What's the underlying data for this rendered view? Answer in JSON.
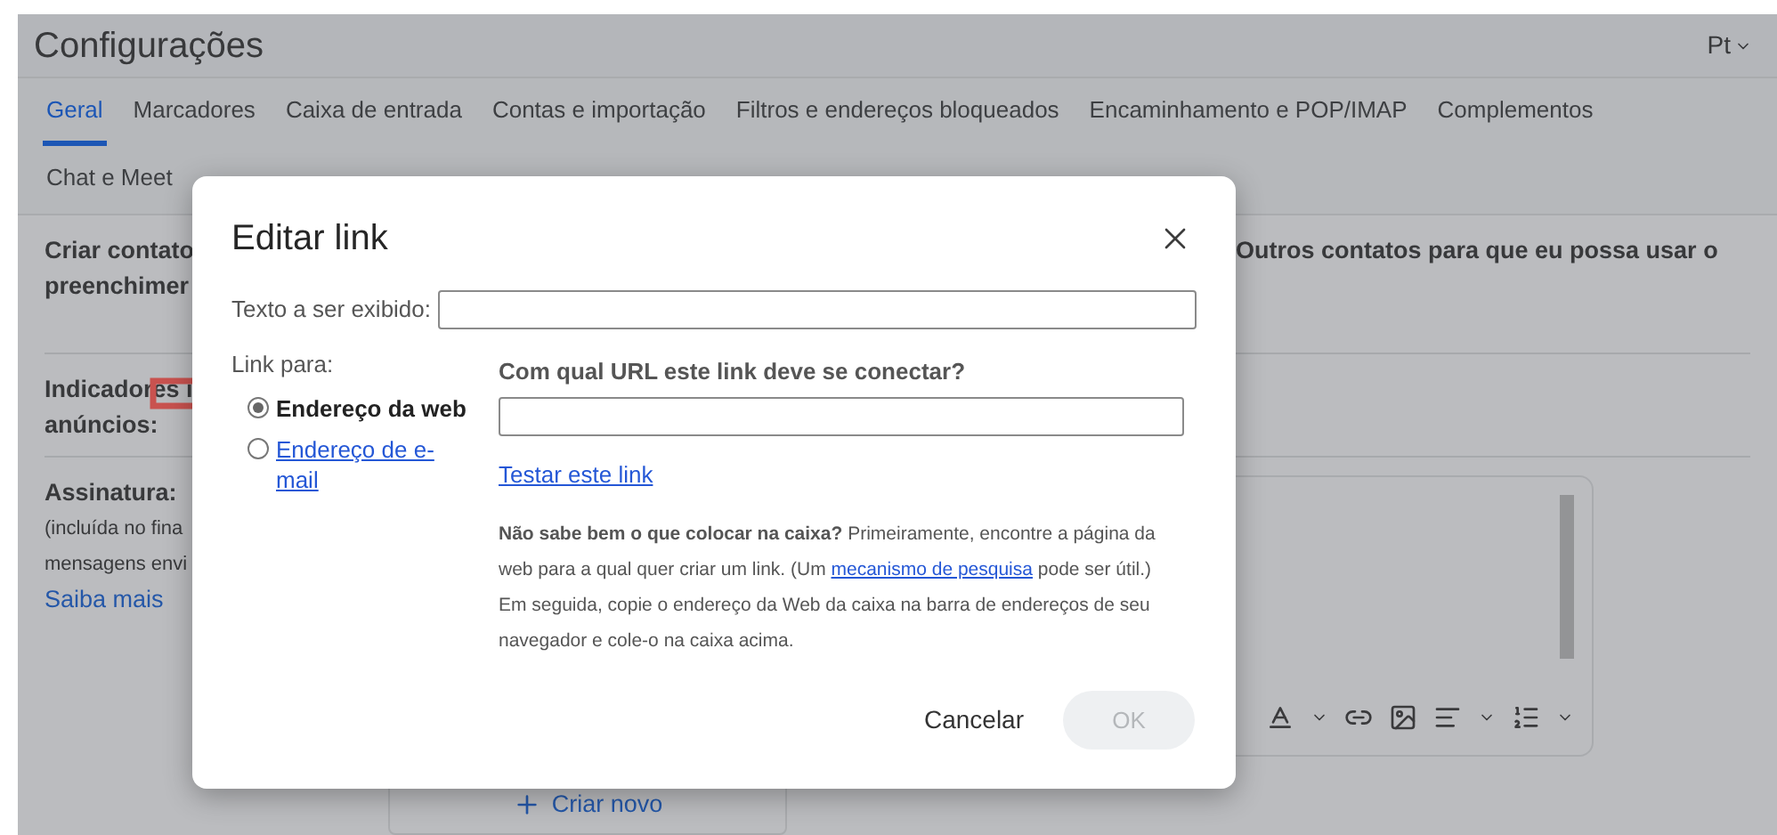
{
  "header": {
    "title": "Configurações",
    "language": "Pt"
  },
  "tabs": [
    {
      "label": "Geral",
      "selected": true
    },
    {
      "label": "Marcadores",
      "selected": false
    },
    {
      "label": "Caixa de entrada",
      "selected": false
    },
    {
      "label": "Contas e importação",
      "selected": false
    },
    {
      "label": "Filtros e endereços bloqueados",
      "selected": false
    },
    {
      "label": "Encaminhamento e POP/IMAP",
      "selected": false
    },
    {
      "label": "Complementos",
      "selected": false
    },
    {
      "label": "Chat e Meet",
      "selected": false
    }
  ],
  "settings": {
    "contacts_label_lines": [
      "Criar contato",
      "preenchimer"
    ],
    "contacts_text": "Outros contatos para que eu possa usar o",
    "ads_label_lines": [
      "Indicadores i",
      "anúncios:"
    ],
    "signature": {
      "label": "Assinatura:",
      "note_lines": [
        "(incluída no fina",
        "mensagens envi"
      ],
      "link": "Saiba mais"
    },
    "create_button": "Criar novo"
  },
  "dialog": {
    "title": "Editar link",
    "display_text_label": "Texto a ser exibido:",
    "link_to_label": "Link para:",
    "options": [
      {
        "label": "Endereço da web",
        "selected": true
      },
      {
        "label": "Endereço de e-mail",
        "selected": false
      }
    ],
    "url_prompt": "Com qual URL este link deve se conectar?",
    "test_link": "Testar este link",
    "help": {
      "lead": "Não sabe bem o que colocar na caixa?",
      "before_link": "Primeiramente, encontre a página da web para a qual quer criar um link. (Um",
      "link": "mecanismo de pesquisa",
      "after_link": "pode ser útil.) Em seguida, copie o endereço da Web da caixa na barra de endereços de seu navegador e cole-o na caixa acima."
    },
    "cancel": "Cancelar",
    "ok": "OK",
    "ok_disabled": true
  }
}
